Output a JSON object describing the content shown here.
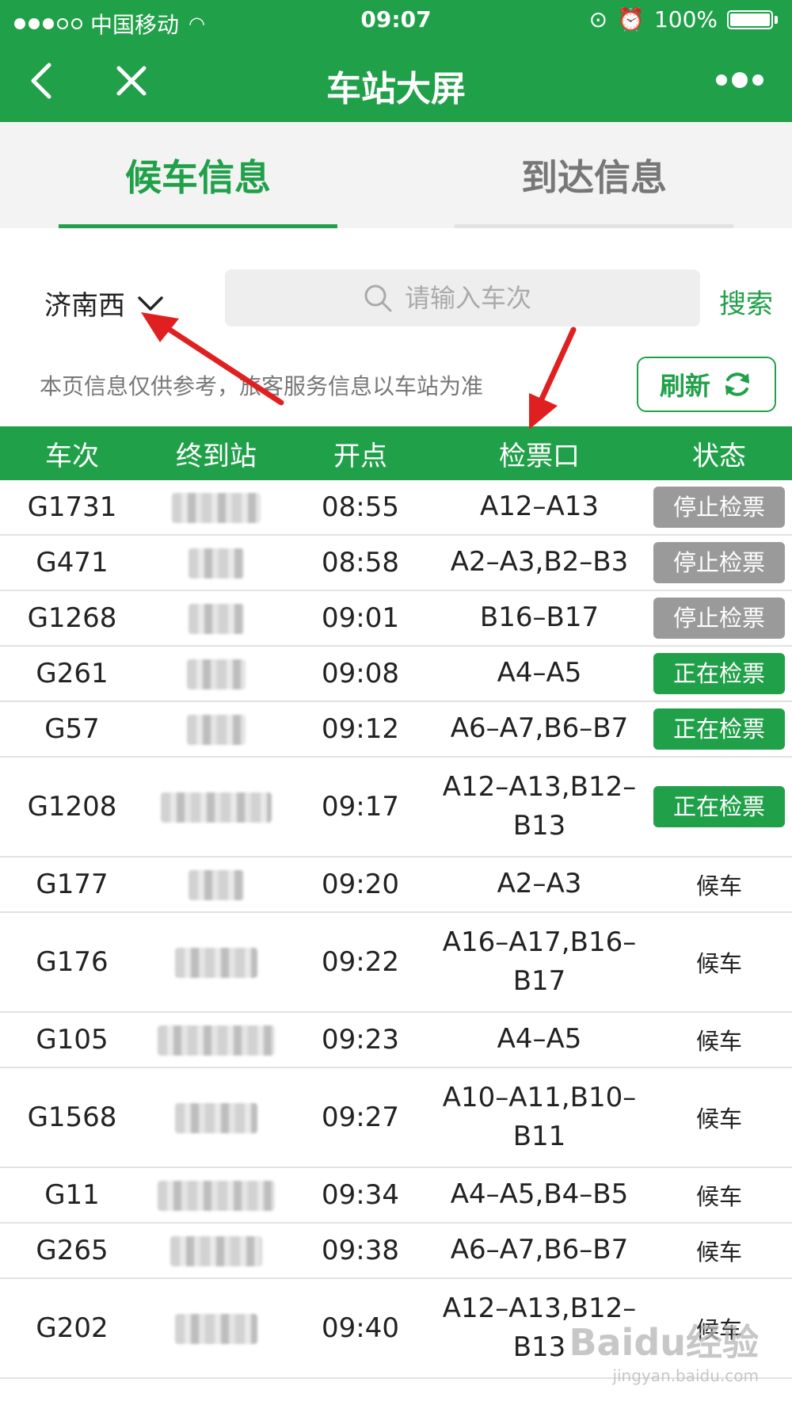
{
  "status_bar": {
    "carrier": "中国移动",
    "time": "09:07",
    "battery": "100%"
  },
  "navbar": {
    "title": "车站大屏"
  },
  "tabs": [
    {
      "label": "候车信息",
      "active": true
    },
    {
      "label": "到达信息",
      "active": false
    }
  ],
  "filter": {
    "station": "济南西",
    "search_placeholder": "请输入车次",
    "search_button": "搜索"
  },
  "notice": "本页信息仅供参考，旅客服务信息以车站为准",
  "refresh_label": "刷新",
  "table": {
    "headers": [
      "车次",
      "终到站",
      "开点",
      "检票口",
      "状态"
    ],
    "rows": [
      {
        "train": "G1731",
        "time": "08:55",
        "gate": "A12–A13",
        "status": "停止检票",
        "kind": "stopped"
      },
      {
        "train": "G471",
        "time": "08:58",
        "gate": "A2–A3,B2–B3",
        "status": "停止检票",
        "kind": "stopped"
      },
      {
        "train": "G1268",
        "time": "09:01",
        "gate": "B16–B17",
        "status": "停止检票",
        "kind": "stopped"
      },
      {
        "train": "G261",
        "time": "09:08",
        "gate": "A4–A5",
        "status": "正在检票",
        "kind": "checking"
      },
      {
        "train": "G57",
        "time": "09:12",
        "gate": "A6–A7,B6–B7",
        "status": "正在检票",
        "kind": "checking"
      },
      {
        "train": "G1208",
        "time": "09:17",
        "gate": "A12–A13,B12–B13",
        "status": "正在检票",
        "kind": "checking"
      },
      {
        "train": "G177",
        "time": "09:20",
        "gate": "A2–A3",
        "status": "候车",
        "kind": "waiting"
      },
      {
        "train": "G176",
        "time": "09:22",
        "gate": "A16–A17,B16–B17",
        "status": "候车",
        "kind": "waiting"
      },
      {
        "train": "G105",
        "time": "09:23",
        "gate": "A4–A5",
        "status": "候车",
        "kind": "waiting"
      },
      {
        "train": "G1568",
        "time": "09:27",
        "gate": "A10–A11,B10–B11",
        "status": "候车",
        "kind": "waiting"
      },
      {
        "train": "G11",
        "time": "09:34",
        "gate": "A4–A5,B4–B5",
        "status": "候车",
        "kind": "waiting"
      },
      {
        "train": "G265",
        "time": "09:38",
        "gate": "A6–A7,B6–B7",
        "status": "候车",
        "kind": "waiting"
      },
      {
        "train": "G202",
        "time": "09:40",
        "gate": "A12–A13,B12–B13",
        "status": "候车",
        "kind": "waiting"
      }
    ]
  },
  "watermark": {
    "brand": "Baidu经验",
    "url": "jingyan.baidu.com"
  },
  "colors": {
    "brand_green": "#21a04a",
    "badge_gray": "#9a9a9a",
    "annotation_red": "#e02020"
  },
  "icons": [
    "back-icon",
    "close-icon",
    "more-icon",
    "chevron-down-icon",
    "search-icon",
    "refresh-icon",
    "wifi-icon",
    "battery-icon"
  ]
}
